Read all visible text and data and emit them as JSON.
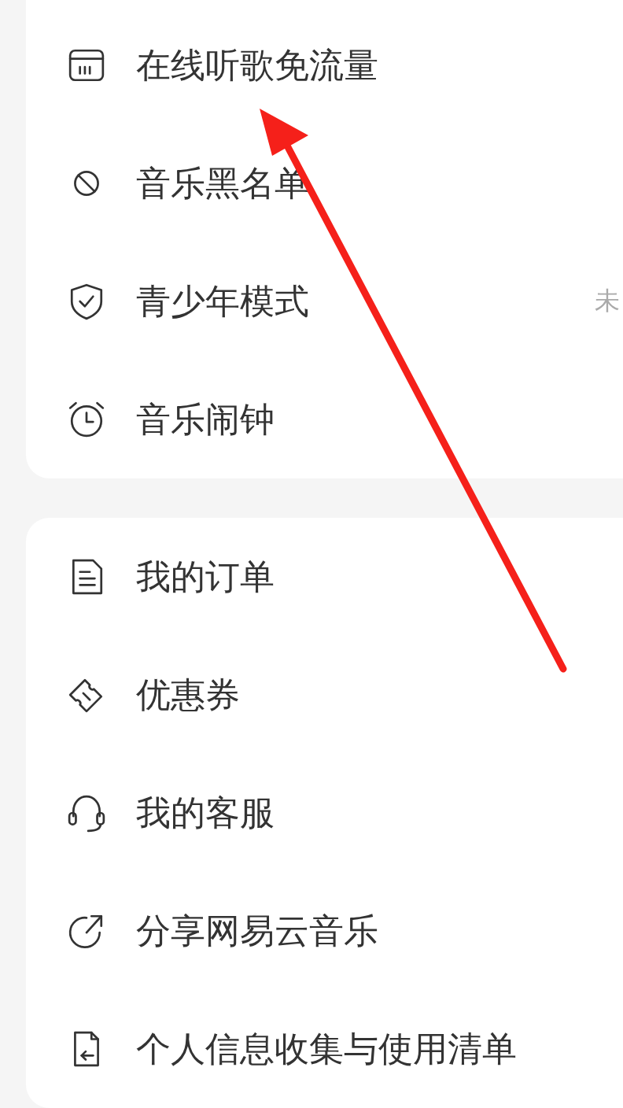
{
  "sections": [
    {
      "items": [
        {
          "kind": "sim",
          "label": "在线听歌免流量"
        },
        {
          "kind": "block",
          "label": "音乐黑名单"
        },
        {
          "kind": "shield",
          "label": "青少年模式",
          "value": "未"
        },
        {
          "kind": "alarm",
          "label": "音乐闹钟"
        }
      ]
    },
    {
      "items": [
        {
          "kind": "document",
          "label": "我的订单"
        },
        {
          "kind": "ticket",
          "label": "优惠券"
        },
        {
          "kind": "headset",
          "label": "我的客服"
        },
        {
          "kind": "share",
          "label": "分享网易云音乐"
        },
        {
          "kind": "file-arrow",
          "label": "个人信息收集与使用清单"
        }
      ]
    }
  ],
  "annotation": {
    "kind": "arrow"
  }
}
